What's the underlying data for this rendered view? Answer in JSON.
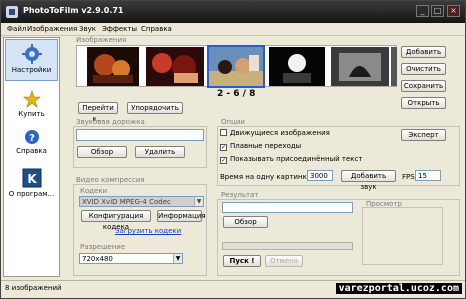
{
  "window": {
    "title": "PhotoToFilm v2.9.0.71"
  },
  "window_controls": {
    "minimize": "_",
    "maximize": "□",
    "close": "×"
  },
  "menu": [
    "Файл",
    "Изображения",
    "Звук",
    "Эффекты",
    "Справка"
  ],
  "sidebar": [
    {
      "label": "Настройки",
      "icon": "gear-icon",
      "active": true
    },
    {
      "label": "Купить",
      "icon": "star-icon"
    },
    {
      "label": "Справка",
      "icon": "help-icon"
    },
    {
      "label": "О програм...",
      "icon": "about-icon"
    }
  ],
  "images_panel": {
    "label": "Изображения",
    "counter": "2 - 6 / 8",
    "goto_button": "Перейти к...",
    "sort_button": "Упорядочить",
    "right_buttons": [
      "Добавить",
      "Очистить",
      "Сохранить",
      "Открыть"
    ]
  },
  "audio_panel": {
    "label": "Звуковая дорожка",
    "browse_button": "Обзор",
    "delete_button": "Удалить"
  },
  "video_panel": {
    "label": "Видео компрессия",
    "codecs_label": "Кодеки",
    "codec_value": "XVID XviD MPEG-4 Codec",
    "config_button": "Конфигурация кодека",
    "info_button": "Информация",
    "download_link": "Загрузить кодеки",
    "resolution_label": "Разрешение",
    "resolution_value": "720x480"
  },
  "options_panel": {
    "label": "Опции",
    "expert_button": "Эксперт",
    "checkboxes": [
      {
        "label": "Движущиеся изображения",
        "checked": false
      },
      {
        "label": "Плавные переходы",
        "checked": true
      },
      {
        "label": "Показывать присоединённый текст",
        "checked": true
      }
    ],
    "time_label": "Время на одну картинку (мс):",
    "time_value": "3000",
    "add_sound_button": "Добавить звук",
    "fps_label": "FPS",
    "fps_value": "15"
  },
  "result_panel": {
    "label": "Результат",
    "browse_button": "Обзор",
    "start_button": "Пуск !",
    "cancel_button": "Отмена",
    "preview_label": "Просмотр"
  },
  "status": {
    "text": "8 изображений"
  },
  "watermark": "varezportal.ucoz.com",
  "colors": {
    "accent": "#2a5bd7",
    "titlebar": "#151515"
  }
}
